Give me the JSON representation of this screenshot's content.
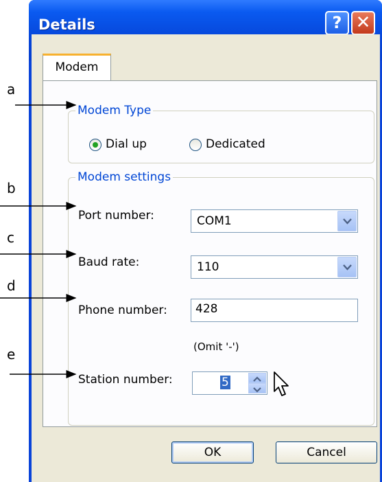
{
  "window": {
    "title": "Details",
    "help_label": "?",
    "close_label": "✕"
  },
  "tabs": [
    {
      "label": "Modem"
    }
  ],
  "modem_type": {
    "legend": "Modem Type",
    "options": [
      {
        "label": "Dial up",
        "selected": true
      },
      {
        "label": "Dedicated",
        "selected": false
      }
    ]
  },
  "modem_settings": {
    "legend": "Modem settings",
    "port_label": "Port number:",
    "port_value": "COM1",
    "baud_label": "Baud rate:",
    "baud_value": "110",
    "phone_label": "Phone number:",
    "phone_value": "428",
    "phone_hint": "(Omit '-')",
    "station_label": "Station number:",
    "station_value": "5"
  },
  "buttons": {
    "ok": "OK",
    "cancel": "Cancel"
  },
  "annotations": [
    "a",
    "b",
    "c",
    "d",
    "e"
  ],
  "colors": {
    "title_bar": "#0645d8",
    "group_legend": "#0046d5",
    "tab_accent": "#f7b12f"
  },
  "icons": {
    "combo": "chevron-down-icon",
    "spin": "spin-arrows-icon",
    "cursor": "mouse-pointer-icon"
  }
}
